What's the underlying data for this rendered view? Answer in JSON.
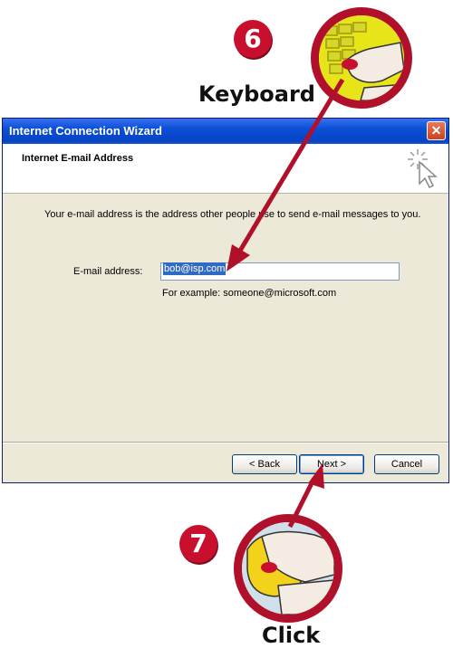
{
  "steps": [
    {
      "number": "6",
      "label": "Keyboard"
    },
    {
      "number": "7",
      "label": "Click"
    }
  ],
  "dialog": {
    "title": "Internet Connection Wizard",
    "close_glyph": "✕",
    "header_title": "Internet E-mail Address",
    "description": "Your e-mail address is the address other people use to send e-mail messages to you.",
    "email_label": "E-mail address:",
    "email_value": "bob@isp.com",
    "example": "For example: someone@microsoft.com",
    "buttons": {
      "back": "< Back",
      "next": "Next >",
      "cancel": "Cancel"
    }
  },
  "icons": {
    "keyboard_photo": "hand-on-keyboard-icon",
    "mouse_photo": "hand-on-mouse-icon",
    "wizard": "cursor-sparkle-icon"
  },
  "colors": {
    "accent": "#c8102e",
    "titlebar": "#0a4fd6",
    "dialog_bg": "#ece9d8"
  }
}
